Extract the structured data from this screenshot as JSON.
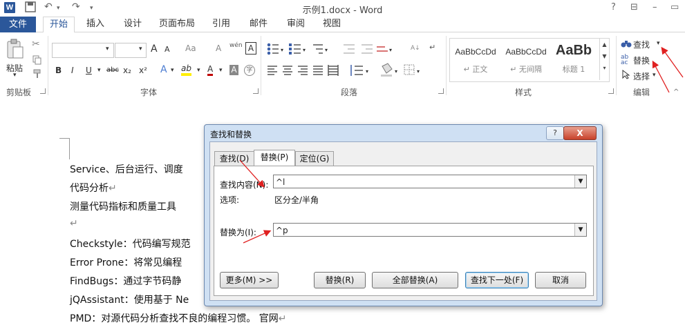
{
  "titlebar": {
    "logo": "W",
    "title": "示例1.docx - Word",
    "help": "?",
    "controls": [
      "⊟",
      "▭"
    ]
  },
  "tabs": {
    "file": "文件",
    "items": [
      "开始",
      "插入",
      "设计",
      "页面布局",
      "引用",
      "邮件",
      "审阅",
      "视图"
    ]
  },
  "ribbon": {
    "clipboard": {
      "paste": "粘贴",
      "label": "剪贴板"
    },
    "font": {
      "label": "字体",
      "bold": "B",
      "italic": "I",
      "underline": "U",
      "strike": "abc",
      "sub": "x₂",
      "sup": "x²",
      "grow": "A",
      "shrink": "A",
      "case": "Aa",
      "clear": "A",
      "phonetic": "wén",
      "border": "A",
      "textfx": "A",
      "highlight": "ab",
      "fontcolor": "A",
      "shade": "A",
      "enclose": "字"
    },
    "paragraph": {
      "label": "段落"
    },
    "styles": {
      "label": "样式",
      "items": [
        {
          "sample": "AaBbCcDd",
          "name": "↵ 正文"
        },
        {
          "sample": "AaBbCcDd",
          "name": "↵ 无间隔"
        },
        {
          "sample": "AaBb",
          "name": "标题 1"
        }
      ]
    },
    "editing": {
      "label": "编辑",
      "find": "查找",
      "replace": "替换",
      "select": "选择"
    }
  },
  "document": {
    "lines": [
      "Service、后台运行、调度",
      "代码分析",
      "测量代码指标和质量工具",
      "",
      "Checkstyle：代码编写规范",
      "Error Prone：将常见编程",
      "FindBugs：通过字节码静",
      "jQAssistant：使用基于 Ne",
      "PMD：对源代码分析查找不良的编程习惯。 官网"
    ]
  },
  "dialog": {
    "title": "查找和替换",
    "help": "?",
    "close": "X",
    "tabs": [
      "查找(D)",
      "替换(P)",
      "定位(G)"
    ],
    "find_label": "查找内容(N):",
    "find_value": "^l",
    "options_label": "选项:",
    "options_value": "区分全/半角",
    "replace_label": "替换为(I):",
    "replace_value": "^p",
    "buttons": {
      "more": "更多(M) >>",
      "replace": "替换(R)",
      "replace_all": "全部替换(A)",
      "find_next": "查找下一处(F)",
      "cancel": "取消"
    }
  },
  "colors": {
    "accent": "#2b579a",
    "arrow": "#e02020"
  }
}
